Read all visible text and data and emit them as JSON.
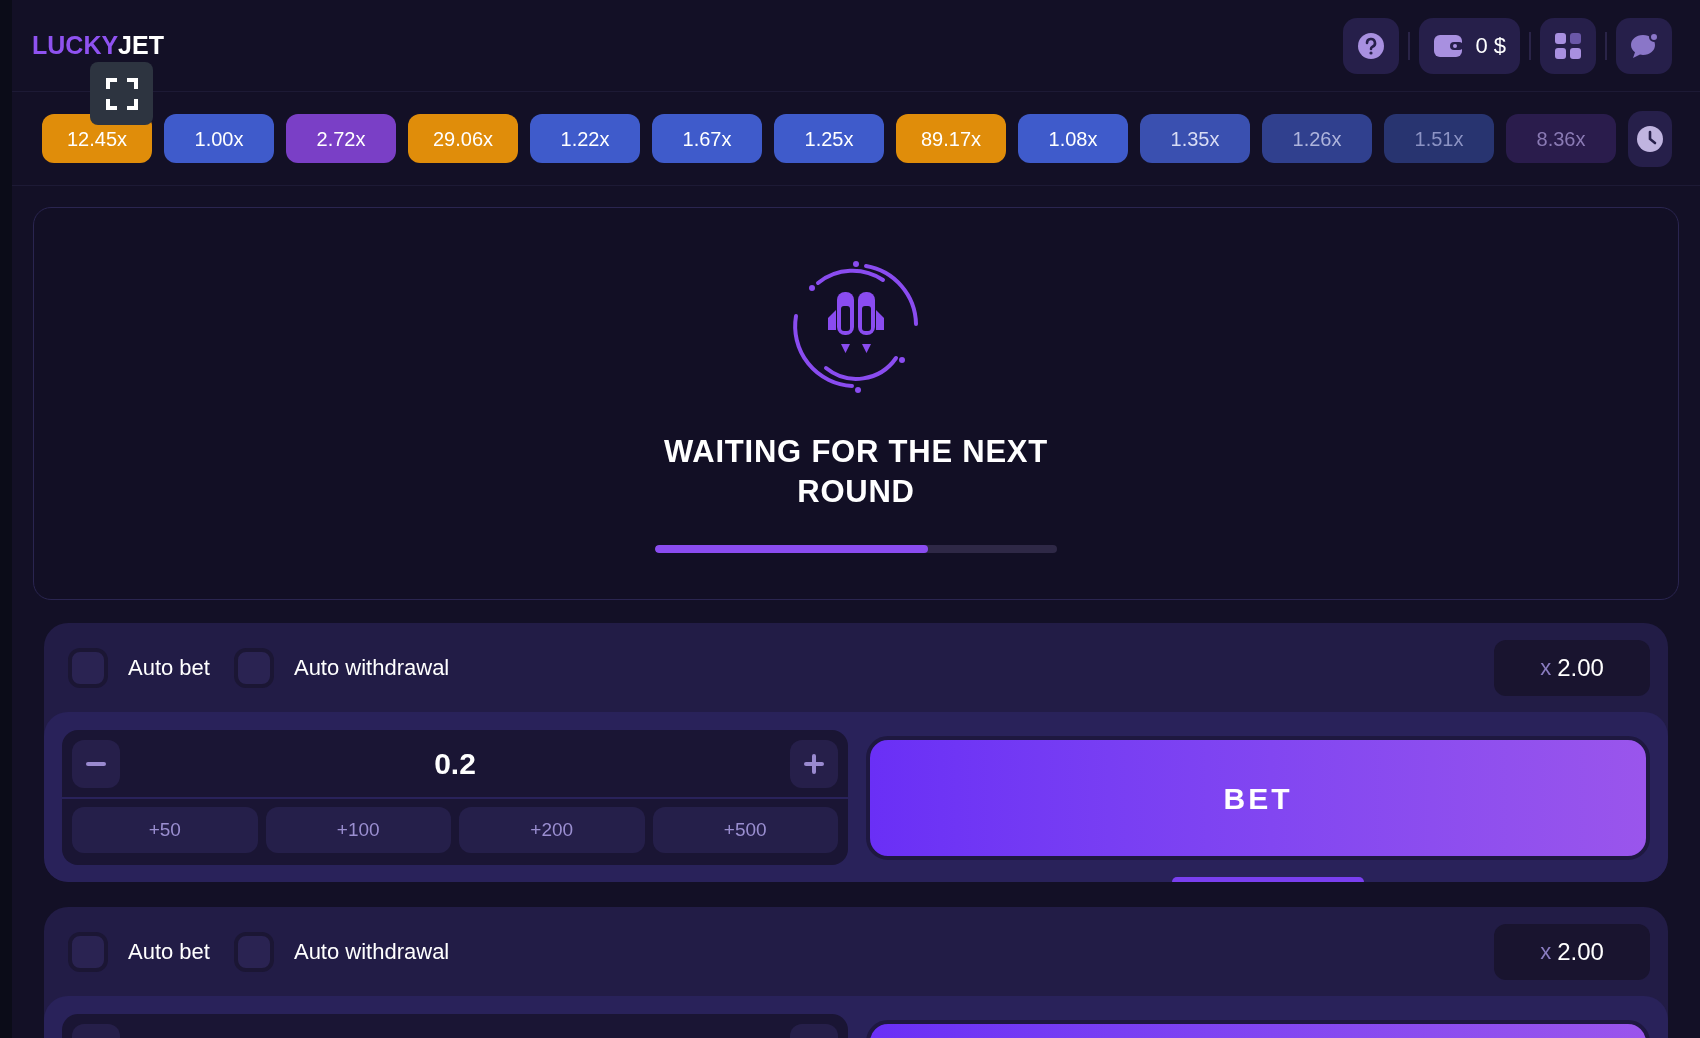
{
  "header": {
    "logo": {
      "part_1": "LUCKY",
      "part_2": "JET"
    },
    "balance": "0 $"
  },
  "history": [
    {
      "value": "12.45x",
      "color": "#e08d0a"
    },
    {
      "value": "1.00x",
      "color": "#3f5bcb"
    },
    {
      "value": "2.72x",
      "color": "#7a3fc6"
    },
    {
      "value": "29.06x",
      "color": "#e08d0a"
    },
    {
      "value": "1.22x",
      "color": "#3f5bcb"
    },
    {
      "value": "1.67x",
      "color": "#3f5bcb"
    },
    {
      "value": "1.25x",
      "color": "#3f5bcb"
    },
    {
      "value": "89.17x",
      "color": "#e08d0a"
    },
    {
      "value": "1.08x",
      "color": "#3f5bcb"
    },
    {
      "value": "1.35x",
      "color": "#3a50b0"
    },
    {
      "value": "1.26x",
      "color": "#30408e"
    },
    {
      "value": "1.51x",
      "color": "#283470"
    },
    {
      "value": "8.36x",
      "color": "#2a1c4c"
    }
  ],
  "game": {
    "status": "WAITING FOR THE NEXT ROUND",
    "level": 0.68
  },
  "bet_panels": [
    {
      "auto_bet": {
        "label": "Auto bet",
        "on": false
      },
      "auto_withdrawal": {
        "label": "Auto withdrawal",
        "on": false
      },
      "multiplier_prefix": "x",
      "multiplier": "2.00",
      "amount": "0.2",
      "quick_adds": [
        "+50",
        "+100",
        "+200",
        "+500"
      ],
      "button": "BET"
    },
    {
      "auto_bet": {
        "label": "Auto bet",
        "on": false
      },
      "auto_withdrawal": {
        "label": "Auto withdrawal",
        "on": false
      },
      "multiplier_prefix": "x",
      "multiplier": "2.00"
    }
  ]
}
